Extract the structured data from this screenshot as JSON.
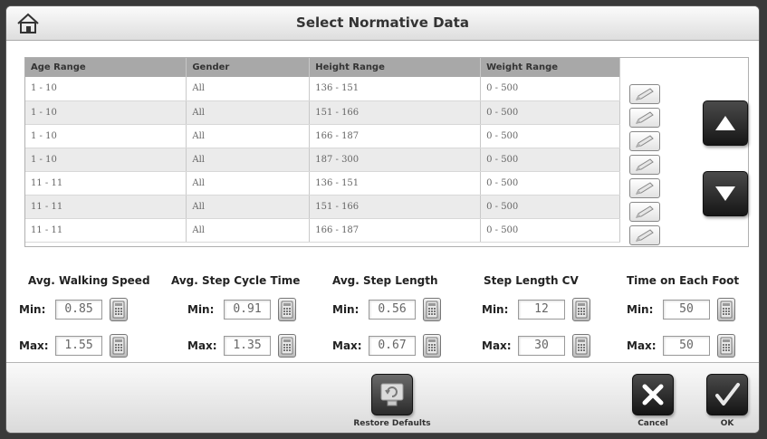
{
  "window": {
    "title": "Select Normative Data"
  },
  "table": {
    "headers": [
      "Age Range",
      "Gender",
      "Height Range",
      "Weight Range"
    ],
    "rows": [
      [
        "1 - 10",
        "All",
        "136 - 151",
        "0 - 500"
      ],
      [
        "1 - 10",
        "All",
        "151 - 166",
        "0 - 500"
      ],
      [
        "1 - 10",
        "All",
        "166 - 187",
        "0 - 500"
      ],
      [
        "1 - 10",
        "All",
        "187 - 300",
        "0 - 500"
      ],
      [
        "11 - 11",
        "All",
        "136 - 151",
        "0 - 500"
      ],
      [
        "11 - 11",
        "All",
        "151 - 166",
        "0 - 500"
      ],
      [
        "11 - 11",
        "All",
        "166 - 187",
        "0 - 500"
      ]
    ]
  },
  "params": {
    "min_label": "Min:",
    "max_label": "Max:",
    "items": [
      {
        "title": "Avg. Walking Speed",
        "min": "0.85",
        "max": "1.55"
      },
      {
        "title": "Avg. Step Cycle Time",
        "min": "0.91",
        "max": "1.35"
      },
      {
        "title": "Avg. Step Length",
        "min": "0.56",
        "max": "0.67"
      },
      {
        "title": "Step Length CV",
        "min": "12",
        "max": "30"
      },
      {
        "title": "Time on Each Foot",
        "min": "50",
        "max": "50"
      }
    ]
  },
  "footer": {
    "restore_label": "Restore Defaults",
    "cancel_label": "Cancel",
    "ok_label": "OK"
  },
  "icons": {
    "home": "home-icon",
    "edit": "pencil-icon",
    "up": "arrow-up-icon",
    "down": "arrow-down-icon",
    "calculator": "calculator-icon",
    "restore": "restore-defaults-icon",
    "cancel": "x-icon",
    "ok": "checkmark-icon"
  },
  "colors": {
    "header_bg": "#a8a8a8",
    "row_shaded": "#ebebeb",
    "dark_button": "#1e1e1e"
  }
}
